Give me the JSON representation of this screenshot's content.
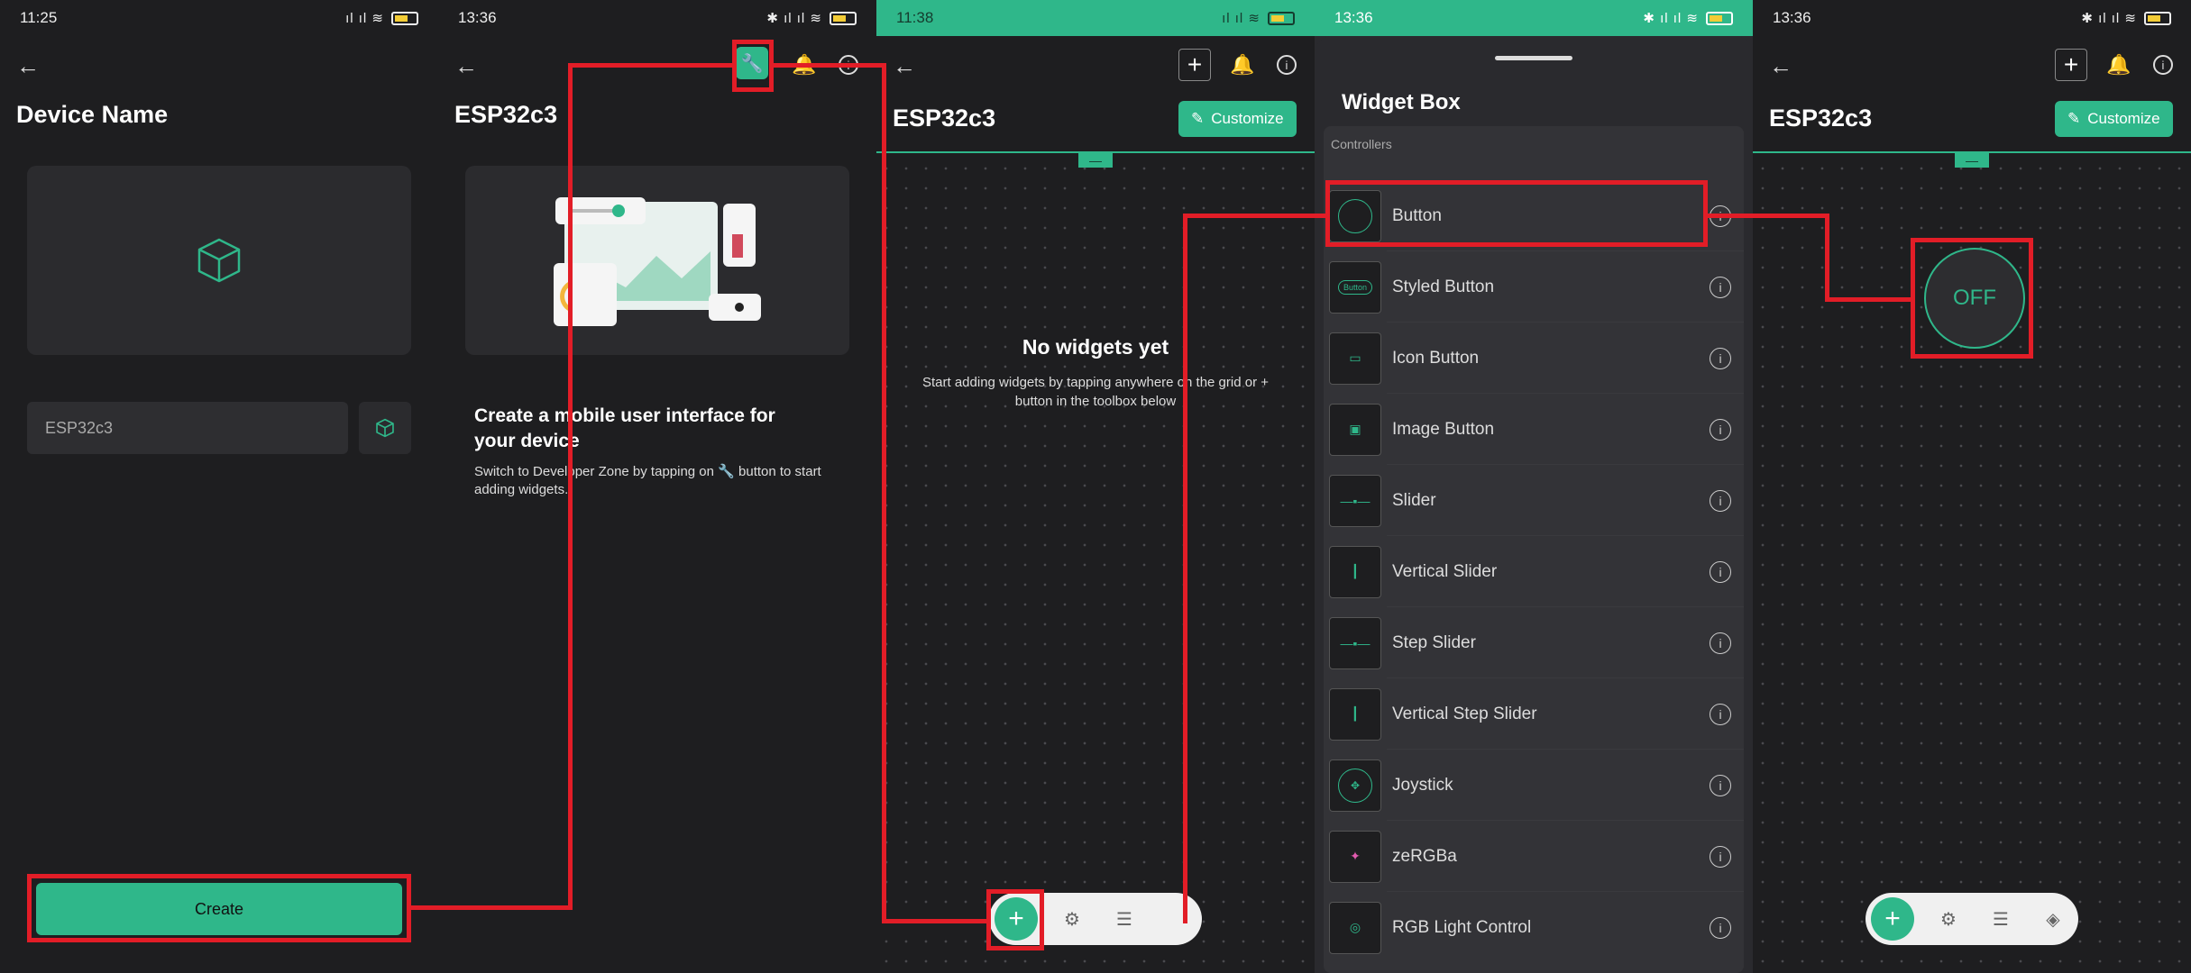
{
  "screen1": {
    "status": {
      "time": "11:25",
      "left_icons": "◂ ··",
      "right_icons": "ıl ıl ≋"
    },
    "title": "Device Name",
    "name_value": "ESP32c3",
    "create_label": "Create"
  },
  "screen2": {
    "status": {
      "time": "13:36",
      "left_icons": "● ··",
      "right_icons": "✱ ıl ıl ≋"
    },
    "title": "ESP32c3",
    "heading": "Create a mobile user interface for your device",
    "body": "Switch to Developer Zone by tapping on 🔧 button to start adding widgets."
  },
  "screen3": {
    "status": {
      "time": "11:38",
      "right_icons": "ıl ıl ≋"
    },
    "title": "ESP32c3",
    "customize_label": "Customize",
    "empty_title": "No widgets yet",
    "empty_body": "Start adding widgets by tapping anywhere on the grid or + button in the toolbox below"
  },
  "screen4": {
    "status": {
      "time": "13:36",
      "left_icons": "● ··",
      "right_icons": "✱ ıl ıl ≋"
    },
    "title": "Widget Box",
    "section": "Controllers",
    "items": [
      {
        "label": "Button",
        "icon": "circle"
      },
      {
        "label": "Styled Button",
        "icon": "Button"
      },
      {
        "label": "Icon Button",
        "icon": "icon"
      },
      {
        "label": "Image Button",
        "icon": "image"
      },
      {
        "label": "Slider",
        "icon": "slider"
      },
      {
        "label": "Vertical Slider",
        "icon": "vslider"
      },
      {
        "label": "Step Slider",
        "icon": "slider"
      },
      {
        "label": "Vertical Step Slider",
        "icon": "vslider"
      },
      {
        "label": "Joystick",
        "icon": "joystick"
      },
      {
        "label": "zeRGBa",
        "icon": "zebra"
      },
      {
        "label": "RGB Light Control",
        "icon": "rgb"
      }
    ]
  },
  "screen5": {
    "status": {
      "time": "13:36",
      "left_icons": "● ··",
      "right_icons": "✱ ıl ıl ≋"
    },
    "title": "ESP32c3",
    "customize_label": "Customize",
    "button_label": "OFF"
  },
  "colors": {
    "accent": "#2fb78a",
    "highlight": "#e21d27",
    "background": "#1e1e20"
  }
}
